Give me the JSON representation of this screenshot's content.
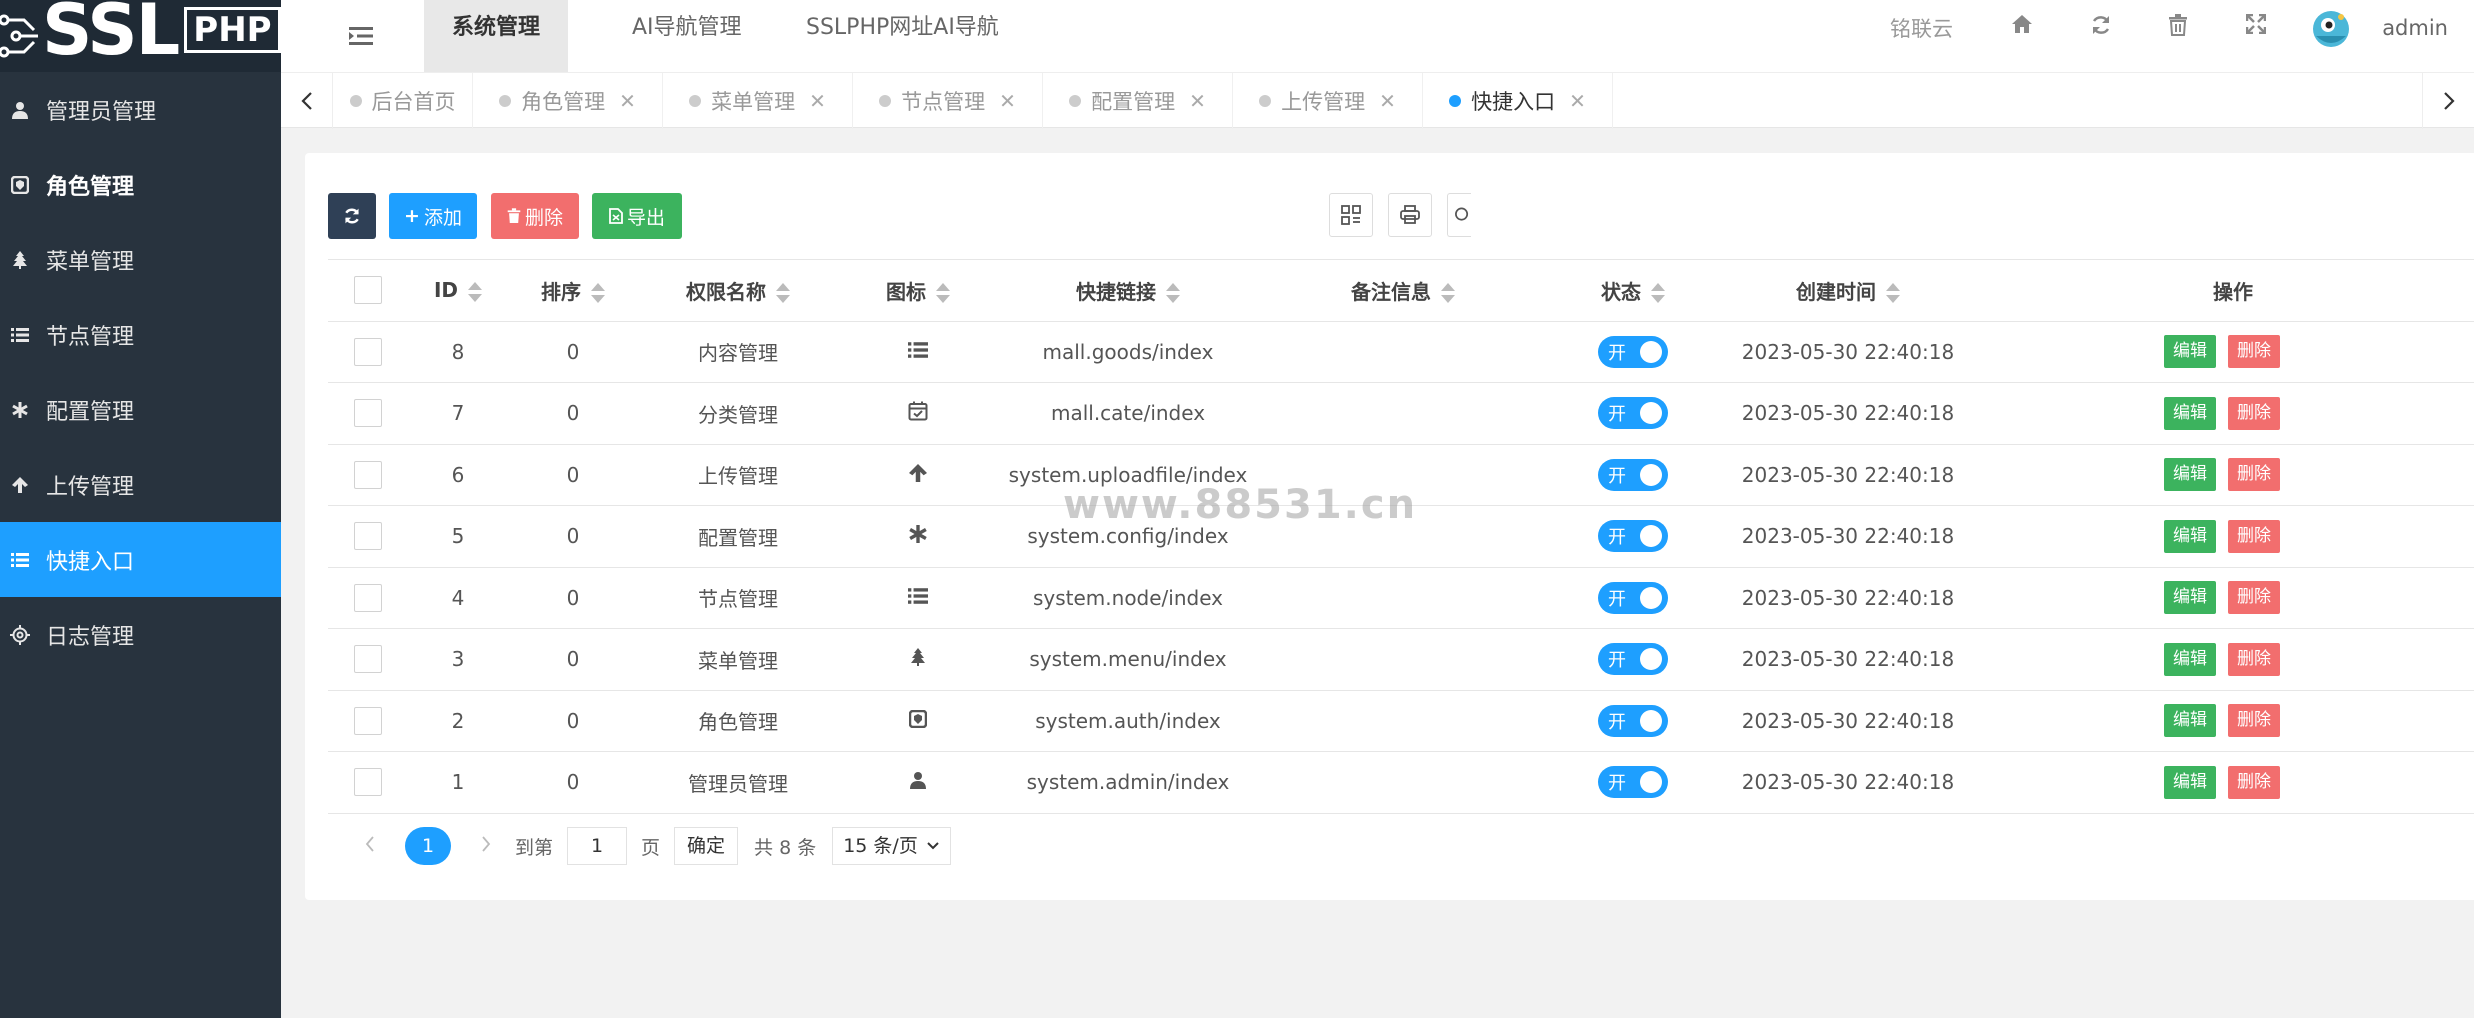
{
  "logo": {
    "text": "SSL",
    "suffix": "PHP"
  },
  "sidebar": {
    "items": [
      {
        "label": "管理员管理",
        "icon": "user-icon"
      },
      {
        "label": "角色管理",
        "icon": "shield-icon"
      },
      {
        "label": "菜单管理",
        "icon": "tree-icon"
      },
      {
        "label": "节点管理",
        "icon": "list-icon"
      },
      {
        "label": "配置管理",
        "icon": "asterisk-icon"
      },
      {
        "label": "上传管理",
        "icon": "arrow-up-icon"
      },
      {
        "label": "快捷入口",
        "icon": "list-icon"
      },
      {
        "label": "日志管理",
        "icon": "gear-icon"
      }
    ]
  },
  "header": {
    "tabs": [
      "系统管理",
      "AI导航管理",
      "SSLPHP网址AI导航"
    ],
    "org": "铭联云",
    "user": "admin"
  },
  "pagetabs": [
    {
      "label": "后台首页",
      "closable": false
    },
    {
      "label": "角色管理",
      "closable": true
    },
    {
      "label": "菜单管理",
      "closable": true
    },
    {
      "label": "节点管理",
      "closable": true
    },
    {
      "label": "配置管理",
      "closable": true
    },
    {
      "label": "上传管理",
      "closable": true
    },
    {
      "label": "快捷入口",
      "closable": true
    }
  ],
  "toolbar": {
    "add": "添加",
    "delete": "删除",
    "export": "导出"
  },
  "table": {
    "headers": [
      "ID",
      "排序",
      "权限名称",
      "图标",
      "快捷链接",
      "备注信息",
      "状态",
      "创建时间",
      "操作"
    ],
    "rows": [
      {
        "id": "8",
        "sort": "0",
        "name": "内容管理",
        "icon": "list-icon",
        "href": "mall.goods/index",
        "remark": "",
        "status": "开",
        "created": "2023-05-30 22:40:18"
      },
      {
        "id": "7",
        "sort": "0",
        "name": "分类管理",
        "icon": "calendar-check-icon",
        "href": "mall.cate/index",
        "remark": "",
        "status": "开",
        "created": "2023-05-30 22:40:18"
      },
      {
        "id": "6",
        "sort": "0",
        "name": "上传管理",
        "icon": "arrow-up-icon",
        "href": "system.uploadfile/index",
        "remark": "",
        "status": "开",
        "created": "2023-05-30 22:40:18"
      },
      {
        "id": "5",
        "sort": "0",
        "name": "配置管理",
        "icon": "asterisk-icon",
        "href": "system.config/index",
        "remark": "",
        "status": "开",
        "created": "2023-05-30 22:40:18"
      },
      {
        "id": "4",
        "sort": "0",
        "name": "节点管理",
        "icon": "list-icon",
        "href": "system.node/index",
        "remark": "",
        "status": "开",
        "created": "2023-05-30 22:40:18"
      },
      {
        "id": "3",
        "sort": "0",
        "name": "菜单管理",
        "icon": "tree-icon",
        "href": "system.menu/index",
        "remark": "",
        "status": "开",
        "created": "2023-05-30 22:40:18"
      },
      {
        "id": "2",
        "sort": "0",
        "name": "角色管理",
        "icon": "shield-icon",
        "href": "system.auth/index",
        "remark": "",
        "status": "开",
        "created": "2023-05-30 22:40:18"
      },
      {
        "id": "1",
        "sort": "0",
        "name": "管理员管理",
        "icon": "user-icon",
        "href": "system.admin/index",
        "remark": "",
        "status": "开",
        "created": "2023-05-30 22:40:18"
      }
    ],
    "edit_label": "编辑",
    "delete_label": "删除"
  },
  "pager": {
    "current": "1",
    "goto_label": "到第",
    "goto_value": "1",
    "page_unit": "页",
    "confirm": "确定",
    "total": "共 8 条",
    "page_size": "15 条/页"
  },
  "watermark": "www.88531.cn",
  "colors": {
    "accent": "#1e9fff",
    "sidebar": "#28333e",
    "edit": "#3cb35e",
    "danger": "#f26e6e",
    "dark_btn": "#2f4056"
  }
}
